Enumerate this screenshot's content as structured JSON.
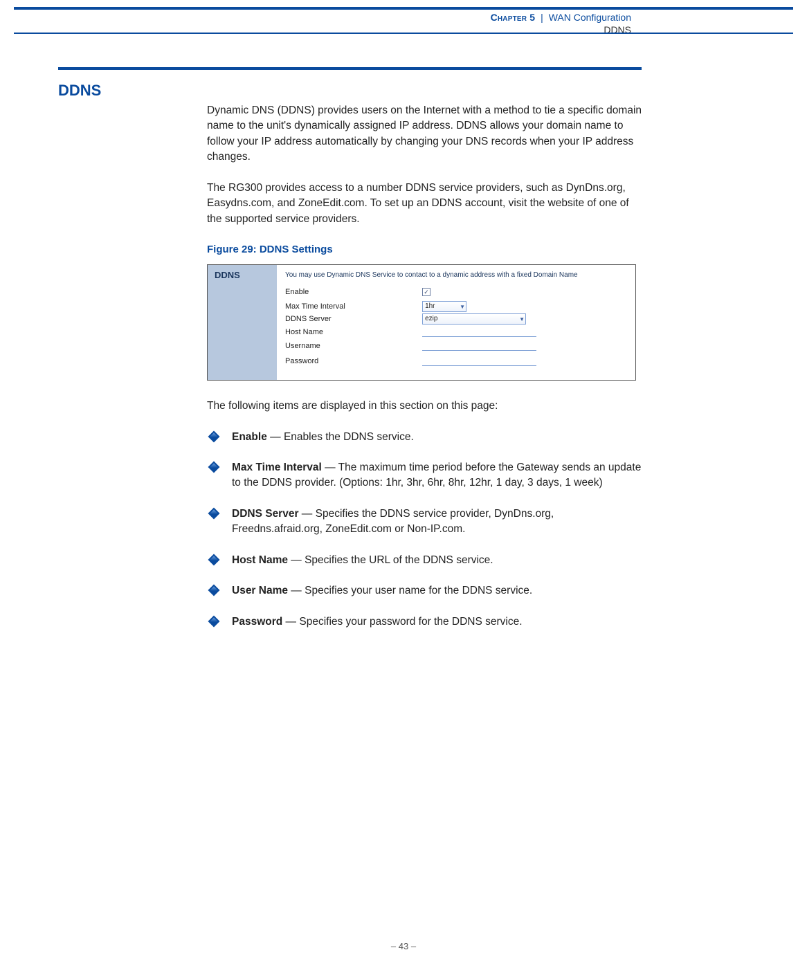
{
  "header": {
    "chapter_label": "Chapter 5",
    "separator": "|",
    "chapter_title": "WAN Configuration",
    "section_label": "DDNS"
  },
  "section": {
    "title": "DDNS",
    "para1": "Dynamic DNS (DDNS) provides users on the Internet with a method to tie a specific domain name to the unit's dynamically assigned IP address. DDNS allows your domain name to follow your IP address automatically by changing your DNS records when your IP address changes.",
    "para2": "The RG300 provides access to a number DDNS service providers, such as DynDns.org, Easydns.com, and ZoneEdit.com. To set up an DDNS account, visit the website of one of the supported service providers."
  },
  "figure": {
    "caption": "Figure 29:  DDNS Settings",
    "panel_title": "DDNS",
    "description": "You may use Dynamic DNS Service to contact to a dynamic address with a fixed Domain Name",
    "rows": {
      "enable": {
        "label": "Enable",
        "checkbox_mark": "✓"
      },
      "interval": {
        "label": "Max Time Interval",
        "value": "1hr"
      },
      "server": {
        "label": "DDNS Server",
        "value": "ezip"
      },
      "host": {
        "label": "Host Name"
      },
      "user": {
        "label": "Username"
      },
      "pass": {
        "label": "Password"
      }
    }
  },
  "lead_in": "The following items are displayed in this section on this page:",
  "bullets": [
    {
      "term": "Enable",
      "dash": " — ",
      "desc": "Enables the DDNS service."
    },
    {
      "term": "Max Time Interval",
      "dash": " — ",
      "desc": "The maximum time period before the Gateway sends an update to the DDNS provider. (Options: 1hr, 3hr, 6hr, 8hr, 12hr, 1 day, 3 days, 1 week)"
    },
    {
      "term": "DDNS Server",
      "dash": " — ",
      "desc": "Specifies the DDNS service provider, DynDns.org, Freedns.afraid.org, ZoneEdit.com or Non-IP.com."
    },
    {
      "term": "Host Name",
      "dash": " — ",
      "desc": "Specifies the URL of the DDNS service."
    },
    {
      "term": "User Name",
      "dash": " — ",
      "desc": "Specifies your user name for the DDNS service."
    },
    {
      "term": "Password",
      "dash": " — ",
      "desc": "Specifies your password for the DDNS service."
    }
  ],
  "footer": {
    "page": "–  43  –"
  }
}
